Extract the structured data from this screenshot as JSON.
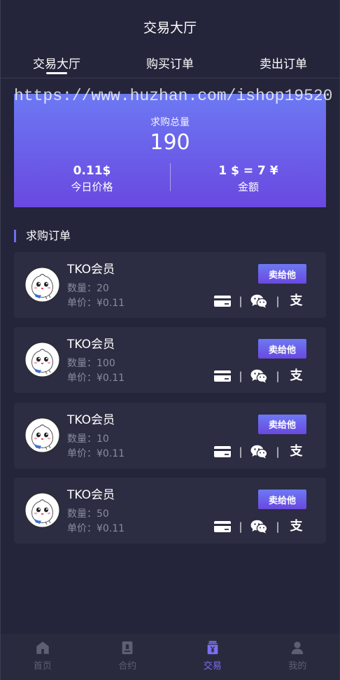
{
  "colors": {
    "background": "#24243a",
    "card": "#2c2c42",
    "accent": "#6b6ff0",
    "accent_dark": "#6a48e0",
    "muted_text": "#8b8ba0",
    "nav_inactive": "#5f5f74",
    "nav_active": "#7b6ff2"
  },
  "header": {
    "title": "交易大厅"
  },
  "tabs": [
    {
      "label": "交易大厅",
      "active": true
    },
    {
      "label": "购买订单",
      "active": false
    },
    {
      "label": "卖出订单",
      "active": false
    }
  ],
  "watermark": "https://www.huzhan.com/ishop19520",
  "summary": {
    "total_label": "求购总量",
    "total_value": "190",
    "price": {
      "value": "0.11$",
      "label": "今日价格"
    },
    "rate": {
      "value": "1 $ = 7 ¥",
      "label": "金额"
    }
  },
  "section": {
    "title": "求购订单"
  },
  "orders": [
    {
      "name": "TKO会员",
      "quantity_label": "数量：",
      "quantity": "20",
      "price_label": "单价：",
      "price": "¥0.11",
      "action_label": "卖给他",
      "avatar": "cartoon-bun-avatar",
      "payment_methods": [
        "bank-card-icon",
        "wechat-pay-icon",
        "alipay-icon"
      ]
    },
    {
      "name": "TKO会员",
      "quantity_label": "数量：",
      "quantity": "100",
      "price_label": "单价：",
      "price": "¥0.11",
      "action_label": "卖给他",
      "avatar": "cartoon-bun-avatar",
      "payment_methods": [
        "bank-card-icon",
        "wechat-pay-icon",
        "alipay-icon"
      ]
    },
    {
      "name": "TKO会员",
      "quantity_label": "数量：",
      "quantity": "10",
      "price_label": "单价：",
      "price": "¥0.11",
      "action_label": "卖给他",
      "avatar": "cartoon-bun-avatar",
      "payment_methods": [
        "bank-card-icon",
        "wechat-pay-icon",
        "alipay-icon"
      ]
    },
    {
      "name": "TKO会员",
      "quantity_label": "数量：",
      "quantity": "50",
      "price_label": "单价：",
      "price": "¥0.11",
      "action_label": "卖给他",
      "avatar": "cartoon-bun-avatar",
      "payment_methods": [
        "bank-card-icon",
        "wechat-pay-icon",
        "alipay-icon"
      ]
    }
  ],
  "payment": {
    "separator": "|",
    "alipay_glyph": "支"
  },
  "bottom_nav": [
    {
      "label": "首页",
      "icon": "home-icon",
      "active": false
    },
    {
      "label": "合约",
      "icon": "contract-icon",
      "active": false
    },
    {
      "label": "交易",
      "icon": "trade-icon",
      "active": true
    },
    {
      "label": "我的",
      "icon": "user-icon",
      "active": false
    }
  ]
}
